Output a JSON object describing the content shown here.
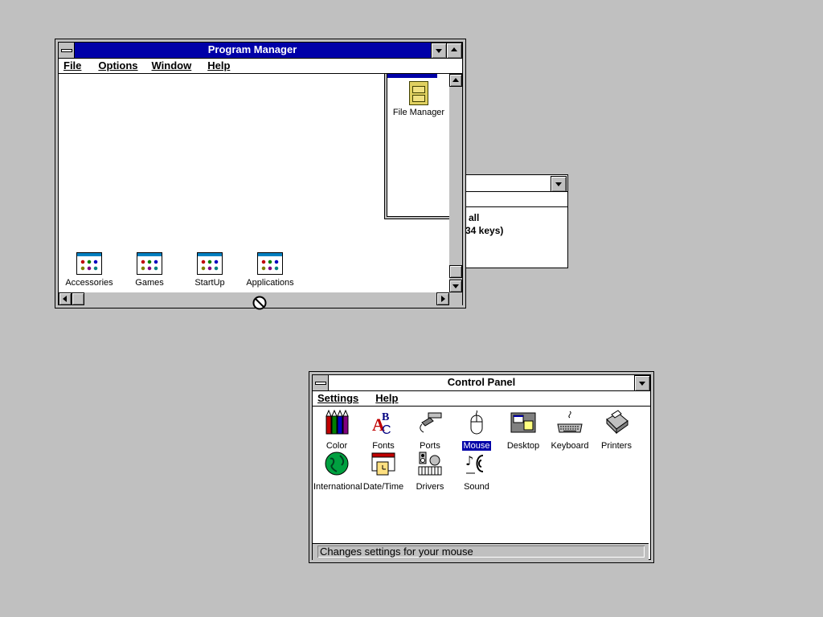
{
  "program_manager": {
    "title": "Program Manager",
    "menu": [
      "File",
      "Options",
      "Window",
      "Help"
    ],
    "groups": [
      {
        "label": "Accessories"
      },
      {
        "label": "Games"
      },
      {
        "label": "StartUp"
      },
      {
        "label": "Applications"
      }
    ],
    "main_group": {
      "items": [
        {
          "label": "File Manager"
        }
      ]
    }
  },
  "background_window": {
    "line1": "all",
    "line2": "34 keys)"
  },
  "control_panel": {
    "title": "Control Panel",
    "menu": [
      "Settings",
      "Help"
    ],
    "icons": [
      {
        "label": "Color",
        "icon": "color-icon"
      },
      {
        "label": "Fonts",
        "icon": "fonts-icon"
      },
      {
        "label": "Ports",
        "icon": "ports-icon"
      },
      {
        "label": "Mouse",
        "icon": "mouse-icon",
        "selected": true
      },
      {
        "label": "Desktop",
        "icon": "desktop-icon"
      },
      {
        "label": "Keyboard",
        "icon": "keyboard-icon"
      },
      {
        "label": "Printers",
        "icon": "printers-icon"
      },
      {
        "label": "International",
        "icon": "international-icon"
      },
      {
        "label": "Date/Time",
        "icon": "datetime-icon"
      },
      {
        "label": "Drivers",
        "icon": "drivers-icon"
      },
      {
        "label": "Sound",
        "icon": "sound-icon"
      }
    ],
    "status": "Changes settings for your mouse"
  },
  "colors": {
    "desktop": "#c0c0c0",
    "active_title": "#0000a8",
    "selection": "#0000a8"
  }
}
